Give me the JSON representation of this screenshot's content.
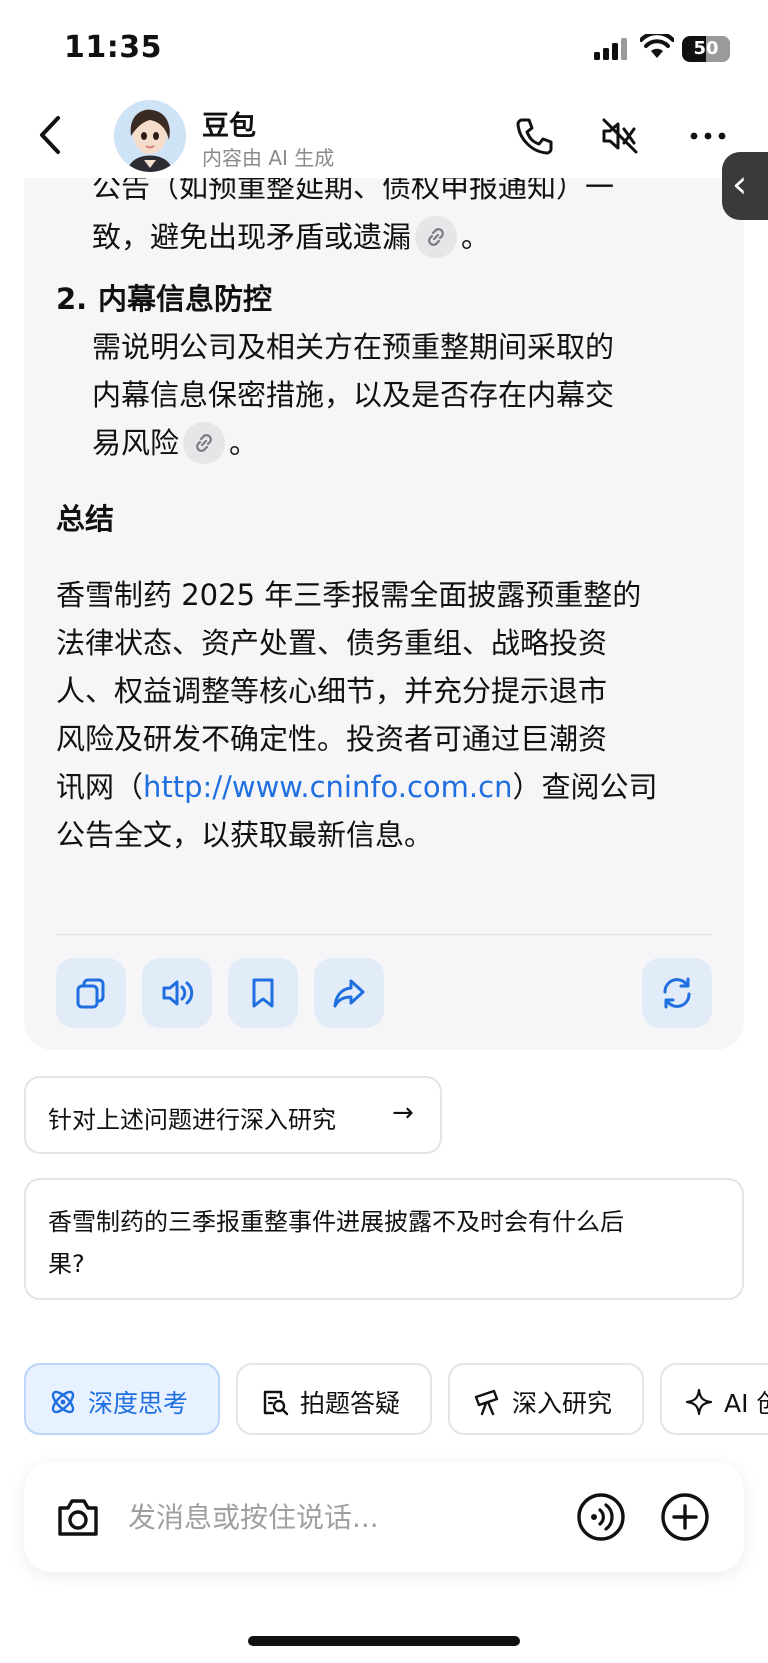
{
  "status_bar": {
    "time": "11:35",
    "battery": "50"
  },
  "header": {
    "bot_name": "豆包",
    "subtitle": "内容由 AI 生成"
  },
  "answer": {
    "line1": "公告（如预重整延期、债权申报通知）一",
    "line2": "致，避免出现矛盾或遗漏",
    "line2_end": "。",
    "item2_number": "2.",
    "item2_title": "内幕信息防控",
    "item2_line1": "需说明公司及相关方在预重整期间采取的",
    "item2_line2": "内幕信息保密措施，以及是否存在内幕交",
    "item2_line3": "易风险",
    "item2_line3_end": "。",
    "summary_heading": "总结",
    "summary_lines": [
      "香雪制药 2025 年三季报需全面披露预重整的",
      "法律状态、资产处置、债务重组、战略投资",
      "人、权益调整等核心细节，并充分提示退市",
      "风险及研发不确定性。投资者可通过巨潮资"
    ],
    "summary_line5_pre": "讯网（",
    "summary_url": "http://www.cninfo.com.cn",
    "summary_line5_post": "）查阅公司",
    "summary_line6": "公告全文，以获取最新信息。"
  },
  "actions": {
    "icons": [
      "copy-icon",
      "speaker-icon",
      "bookmark-icon",
      "share-icon",
      "regenerate-icon"
    ]
  },
  "suggestions": [
    {
      "text": "针对上述问题进行深入研究",
      "arrow": "→"
    },
    {
      "text_line1": "香雪制药的三季报重整事件进展披露不及时会有什么后",
      "text_line2": "果?"
    }
  ],
  "feature_chips": [
    {
      "label": "深度思考",
      "active": true
    },
    {
      "label": "拍题答疑",
      "active": false
    },
    {
      "label": "深入研究",
      "active": false
    },
    {
      "label": "AI 创",
      "active": false
    }
  ],
  "input": {
    "placeholder": "发消息或按住说话..."
  },
  "colors": {
    "accent": "#1f6fe0",
    "chip_active_bg": "#e8f1ff",
    "action_bg": "#e2ecf8"
  }
}
